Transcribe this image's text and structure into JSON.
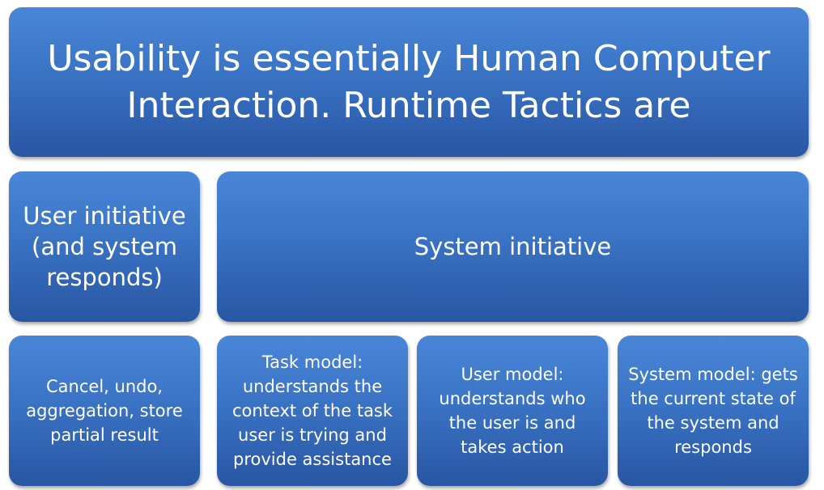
{
  "title": {
    "line1": "Usability is essentially Human Computer",
    "line2": "Interaction. Runtime Tactics are"
  },
  "categories": {
    "user_initiative": "User initiative (and system responds)",
    "system_initiative": "System initiative"
  },
  "tactics": [
    {
      "text": "Cancel, undo, aggregation, store partial result"
    },
    {
      "text": "Task model: understands the context of the task user is trying and provide assistance"
    },
    {
      "text": "User model: understands who the user is and takes action"
    },
    {
      "text": "System model: gets the current state of the system and responds"
    }
  ]
}
